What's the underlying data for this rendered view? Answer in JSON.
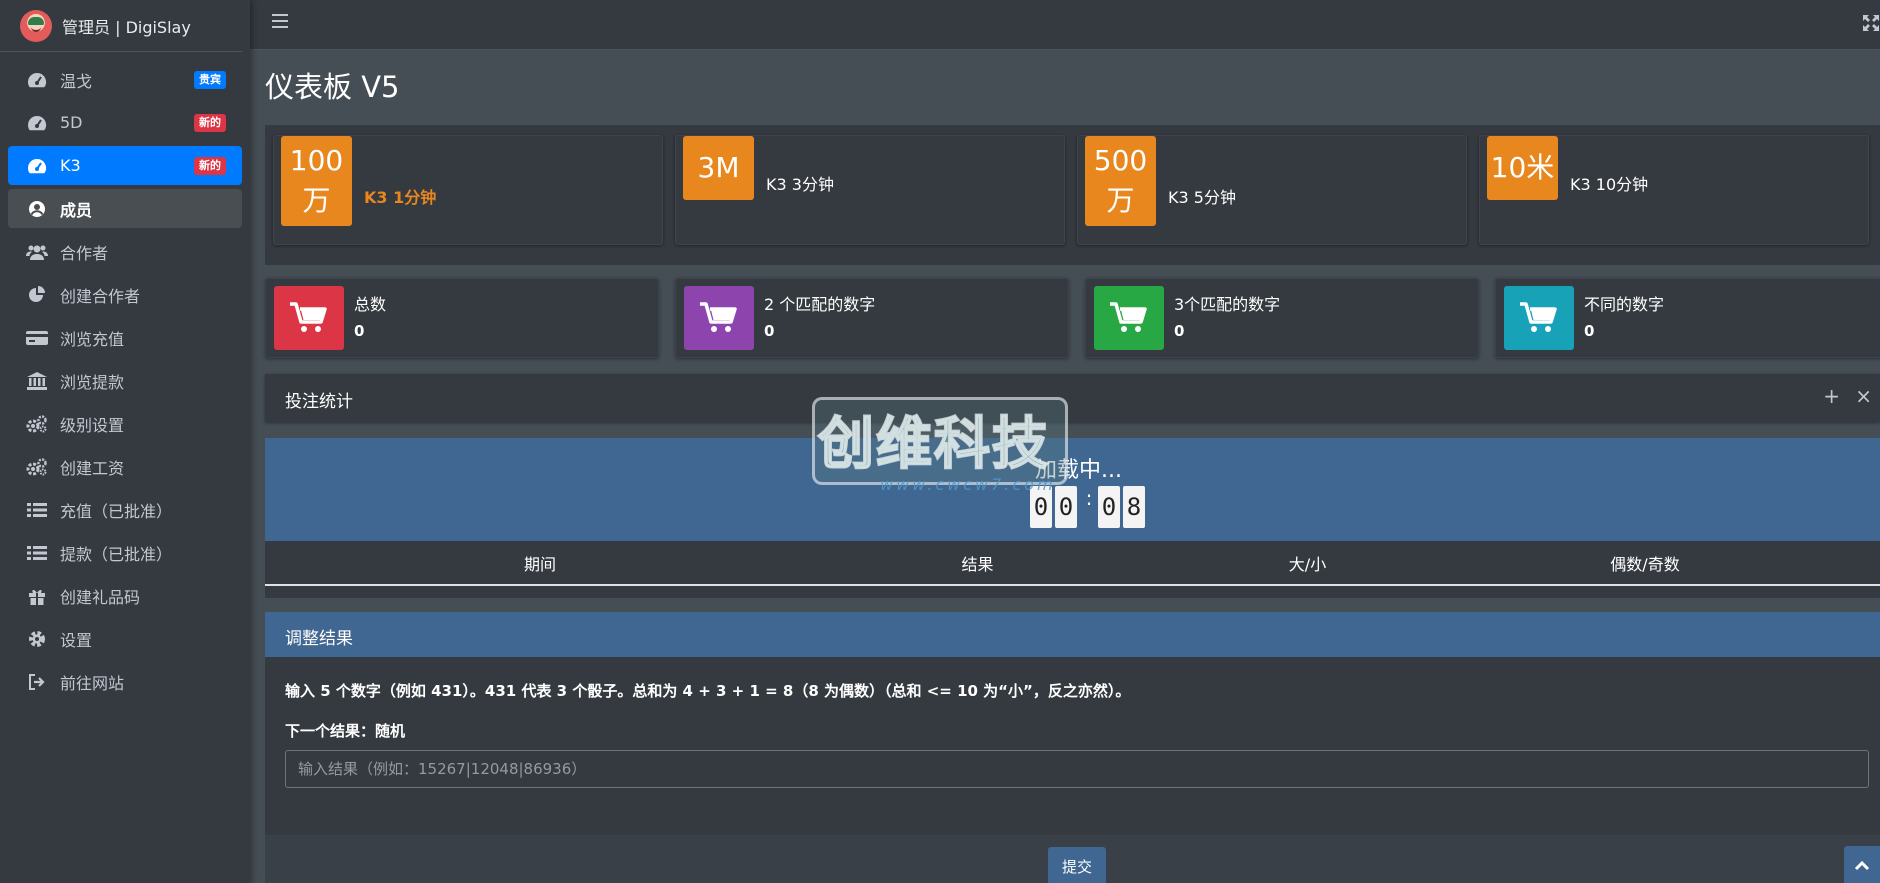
{
  "brand": {
    "title": "管理员 | DigiSlay"
  },
  "sidebar": {
    "items": [
      {
        "label": "温戈",
        "icon": "tachometer-icon",
        "badge": "贵宾",
        "badge_color": "#007bff"
      },
      {
        "label": "5D",
        "icon": "tachometer-icon",
        "badge": "新的",
        "badge_color": "#dc3545"
      },
      {
        "label": "K3",
        "icon": "tachometer-icon",
        "badge": "新的",
        "badge_color": "#dc3545",
        "active": true
      },
      {
        "label": "成员",
        "icon": "user-circle-icon",
        "hover": true
      },
      {
        "label": "合作者",
        "icon": "users-icon"
      },
      {
        "label": "创建合作者",
        "icon": "pie-chart-icon"
      },
      {
        "label": "浏览充值",
        "icon": "credit-card-icon"
      },
      {
        "label": "浏览提款",
        "icon": "bank-icon"
      },
      {
        "label": "级别设置",
        "icon": "cogs-icon"
      },
      {
        "label": "创建工资",
        "icon": "cogs-icon"
      },
      {
        "label": "充值（已批准）",
        "icon": "list-icon"
      },
      {
        "label": "提款（已批准）",
        "icon": "list-icon"
      },
      {
        "label": "创建礼品码",
        "icon": "gift-icon"
      },
      {
        "label": "设置",
        "icon": "gear-icon"
      },
      {
        "label": "前往网站",
        "icon": "sign-out-icon"
      }
    ]
  },
  "page": {
    "title": "仪表板 V5"
  },
  "games": [
    {
      "icon_line1": "100",
      "icon_line2": "万",
      "label": "K3 1分钟",
      "highlight": true
    },
    {
      "icon_line1": "3M",
      "icon_line2": "",
      "label": "K3 3分钟"
    },
    {
      "icon_line1": "500",
      "icon_line2": "万",
      "label": "K3 5分钟"
    },
    {
      "icon_line1": "10米",
      "icon_line2": "",
      "label": "K3 10分钟"
    }
  ],
  "stats": [
    {
      "label": "总数",
      "value": "0",
      "color": "#dc3545"
    },
    {
      "label": "2 个匹配的数字",
      "value": "0",
      "color": "#8e44ad"
    },
    {
      "label": "3个匹配的数字",
      "value": "0",
      "color": "#28a745"
    },
    {
      "label": "不同的数字",
      "value": "0",
      "color": "#17a2b8"
    }
  ],
  "bet_stats": {
    "title": "投注统计",
    "tool_plus": "+",
    "tool_close": "×",
    "loading": "加载中...",
    "timer": [
      "0",
      "0",
      "0",
      "8"
    ],
    "timer_sep": ":",
    "columns": [
      "期间",
      "结果",
      "大/小",
      "偶数/奇数"
    ]
  },
  "adjust": {
    "title": "调整结果",
    "instructions": "输入 5 个数字（例如 431）。431 代表 3 个骰子。总和为 4 + 3 + 1 = 8（8 为偶数）（总和 <= 10 为“小”，反之亦然）。",
    "next_result": "下一个结果：随机",
    "placeholder": "输入结果（例如：15267|12048|86936）",
    "submit": "提交"
  },
  "watermark": {
    "text": "创维科技",
    "url": "www.cwcw7.com"
  }
}
